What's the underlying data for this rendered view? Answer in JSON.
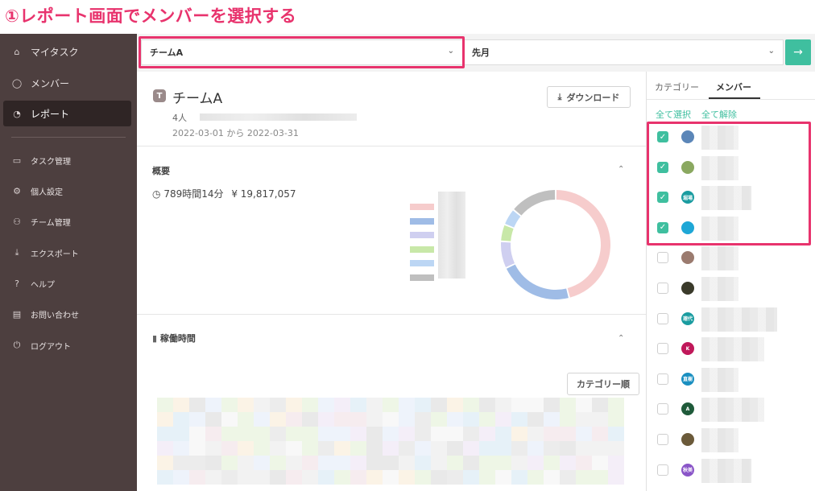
{
  "banner": {
    "text": "①レポート画面でメンバーを選択する"
  },
  "sidebar": {
    "items": [
      {
        "label": "マイタスク",
        "icon": "home-icon",
        "glyph": "⌂"
      },
      {
        "label": "メンバー",
        "icon": "user-icon",
        "glyph": "◯"
      },
      {
        "label": "レポート",
        "icon": "report-icon",
        "glyph": "◔",
        "active": true
      },
      {
        "label": "タスク管理",
        "icon": "inbox-icon",
        "glyph": "▭"
      },
      {
        "label": "個人設定",
        "icon": "gear-icon",
        "glyph": "⚙"
      },
      {
        "label": "チーム管理",
        "icon": "team-icon",
        "glyph": "⚇"
      },
      {
        "label": "エクスポート",
        "icon": "download-icon",
        "glyph": "⤓"
      },
      {
        "label": "ヘルプ",
        "icon": "help-icon",
        "glyph": "?"
      },
      {
        "label": "お問い合わせ",
        "icon": "chat-icon",
        "glyph": "▤"
      },
      {
        "label": "ログアウト",
        "icon": "power-icon",
        "glyph": "⏻"
      }
    ]
  },
  "topbar": {
    "team_select": "チームA",
    "period_select": "先月",
    "go_glyph": "→"
  },
  "report": {
    "badge": "T",
    "team_name": "チームA",
    "members_count": "4人",
    "date_range": "2022-03-01 から 2022-03-31",
    "download_label": "ダウンロード",
    "overview_title": "概要",
    "summary_time": "789時間14分",
    "summary_amount": "¥ 19,817,057",
    "worktime_title": "稼働時間",
    "category_order_label": "カテゴリー順"
  },
  "chart_data": {
    "type": "pie",
    "donut": true,
    "categories": [
      "",
      "",
      "",
      "",
      "",
      ""
    ],
    "values": [
      46,
      22,
      8,
      5,
      5,
      14
    ],
    "colors": [
      "#f6cccc",
      "#9fbce6",
      "#cfcff0",
      "#c8e8a8",
      "#bcd6f4",
      "#bfbfbf"
    ]
  },
  "right_panel": {
    "tab_category": "カテゴリー",
    "tab_members": "メンバー",
    "select_all": "全て選択",
    "deselect_all": "全て解除",
    "members": [
      {
        "checked": true,
        "avatar_color": "#5b86b8",
        "avatar_text": ""
      },
      {
        "checked": true,
        "avatar_color": "#8aa860",
        "avatar_text": ""
      },
      {
        "checked": true,
        "avatar_color": "#1a9ca0",
        "avatar_text": "堀場"
      },
      {
        "checked": true,
        "avatar_color": "#1ea7d6",
        "avatar_text": ""
      },
      {
        "checked": false,
        "avatar_color": "#9b7b6f",
        "avatar_text": ""
      },
      {
        "checked": false,
        "avatar_color": "#3a3a2a",
        "avatar_text": ""
      },
      {
        "checked": false,
        "avatar_color": "#1a9ca0",
        "avatar_text": "瑠代"
      },
      {
        "checked": false,
        "avatar_color": "#c0185a",
        "avatar_text": "K"
      },
      {
        "checked": false,
        "avatar_color": "#1a8fc0",
        "avatar_text": "直樹"
      },
      {
        "checked": false,
        "avatar_color": "#1f5a3a",
        "avatar_text": "A"
      },
      {
        "checked": false,
        "avatar_color": "#6b5a3a",
        "avatar_text": ""
      },
      {
        "checked": false,
        "avatar_color": "#8a55c8",
        "avatar_text": "秋美"
      }
    ]
  }
}
